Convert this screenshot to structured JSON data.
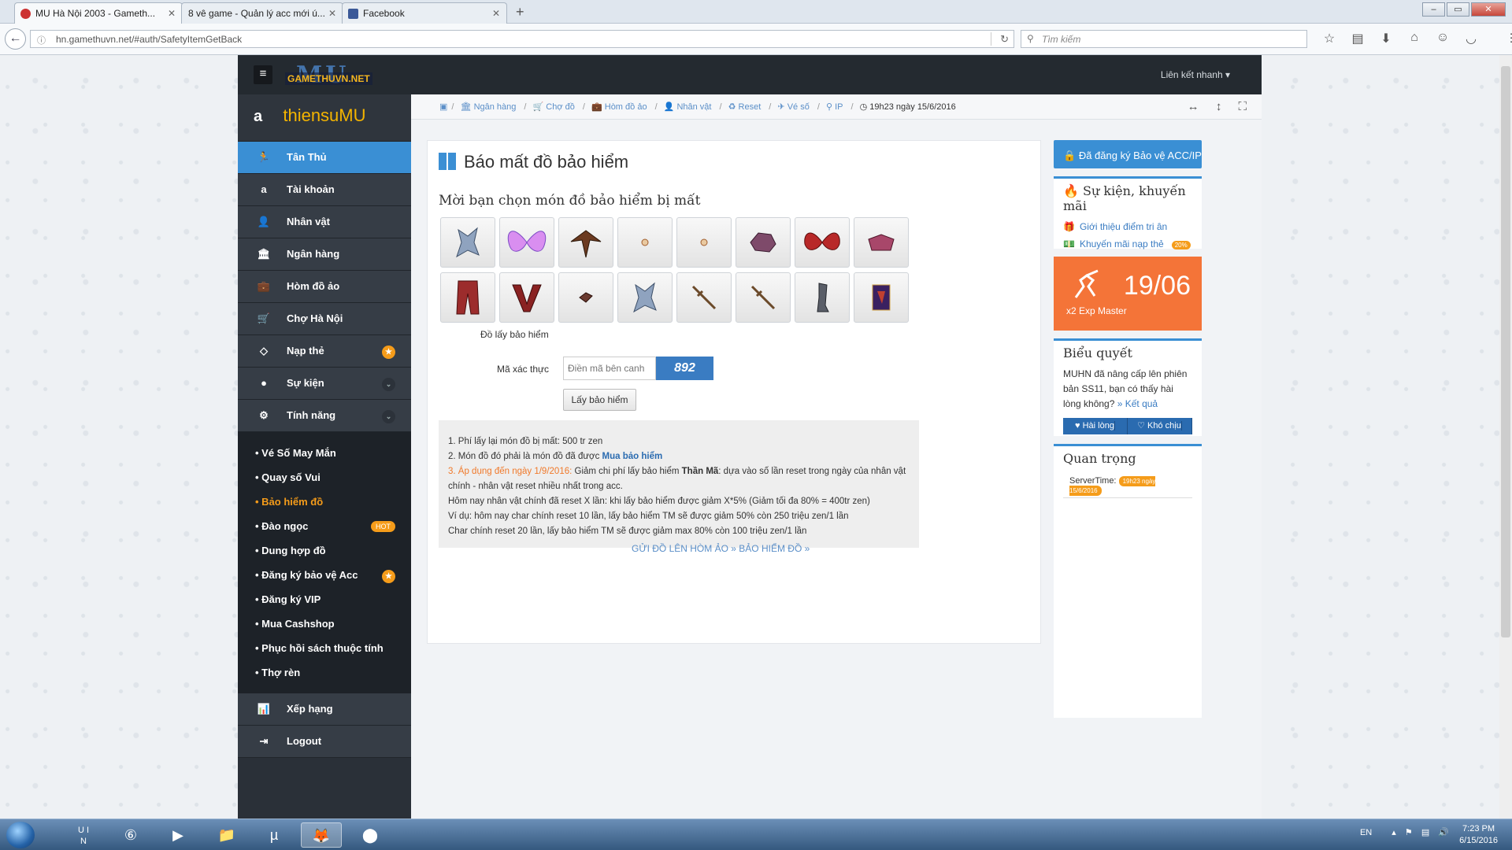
{
  "browser": {
    "tabs": [
      {
        "title": "MU Hà Nội 2003 - Gameth..."
      },
      {
        "title": "8 vê game - Quản lý acc mới ú..."
      },
      {
        "title": "Facebook"
      }
    ],
    "url": "hn.gamethuvn.net/#auth/SafetyItemGetBack",
    "search_placeholder": "Tìm kiếm"
  },
  "header": {
    "logo_big": "MU",
    "logo_small": "GAMETHUVN.NET",
    "quick_link": "Liên kết nhanh"
  },
  "sidebar": {
    "username": "thiensuMU",
    "items": [
      {
        "label": "Tân Thủ",
        "icon": "user-run-icon"
      },
      {
        "label": "Tài khoản",
        "icon": "amazon-icon"
      },
      {
        "label": "Nhân vật",
        "icon": "user-icon"
      },
      {
        "label": "Ngân hàng",
        "icon": "bank-icon"
      },
      {
        "label": "Hòm đồ ảo",
        "icon": "briefcase-icon"
      },
      {
        "label": "Chợ Hà Nội",
        "icon": "cart-icon"
      },
      {
        "label": "Nạp thẻ",
        "icon": "diamond-icon"
      },
      {
        "label": "Sự kiện",
        "icon": "apple-icon"
      },
      {
        "label": "Tính năng",
        "icon": "gears-icon"
      }
    ],
    "sub_items": [
      {
        "label": "• Vé Số May Mắn"
      },
      {
        "label": "• Quay số Vui"
      },
      {
        "label": "• Bảo hiểm đồ"
      },
      {
        "label": "• Đào ngọc",
        "badge": "HOT"
      },
      {
        "label": "• Dung hợp đồ"
      },
      {
        "label": "• Đăng ký bảo vệ Acc"
      },
      {
        "label": "• Đăng ký VIP"
      },
      {
        "label": "• Mua Cashshop"
      },
      {
        "label": "• Phục hồi sách thuộc tính"
      },
      {
        "label": "• Thợ rèn"
      }
    ],
    "bottom_items": [
      {
        "label": "Xếp hạng"
      },
      {
        "label": "Logout"
      }
    ]
  },
  "breadcrumb": {
    "items": [
      "Ngân hàng",
      "Chợ đồ",
      "Hòm đồ ảo",
      "Nhân vật",
      "Reset",
      "Vé số",
      "IP"
    ],
    "time": "19h23 ngày 15/6/2016"
  },
  "main": {
    "title": "Báo mất đồ bảo hiểm",
    "choose_label": "Mời bạn chọn món đồ bảo hiểm bị mất",
    "items_caption": "Đồ lấy bảo hiểm",
    "captcha_label": "Mã xác thực",
    "captcha_placeholder": "Điền mã bên canh",
    "captcha_code": "892",
    "submit_label": "Lấy bảo hiểm",
    "notes": {
      "line1": "1. Phí lấy lại món đồ bị mất: 500 tr zen",
      "line2_prefix": "2. Món đồ đó phải là món đồ đã được ",
      "line2_link": "Mua bảo hiểm",
      "line3_orange": "3. Áp dụng đến ngày 1/9/2016:",
      "line3_a": " Giảm chi phí lấy bảo hiểm ",
      "line3_bold": "Thần Mã",
      "line3_b": ": dựa vào số lần reset trong ngày của nhân vật chính - nhân vật reset nhiều nhất trong acc.",
      "line4": "Hôm nay nhân vật chính đã reset X lần: khi lấy bảo hiểm được giảm X*5% (Giảm tối đa 80% = 400tr zen)",
      "line5": "Ví dụ: hôm nay char chính reset 10 lần, lấy bảo hiểm TM sẽ được giảm 50% còn 250 triệu zen/1 lần",
      "line6": "Char chính reset 20 lần, lấy bảo hiểm TM sẽ được giảm max 80% còn 100 triệu zen/1 lần"
    },
    "footer_link1": "GỬI ĐỒ LÊN HÒM ẢO",
    "footer_link2": "BẢO HIỂM ĐỒ"
  },
  "right": {
    "register_btn": "Đã đăng ký Bảo vệ ACC/IP",
    "events_title": "Sự kiện, khuyến mãi",
    "event_link1": "Giới thiệu điểm tri ân",
    "event_link2": "Khuyến mãi nạp thẻ",
    "event_badge": "20%",
    "promo_date": "19/06",
    "promo_label": "x2 Exp Master",
    "poll_title": "Biểu quyết",
    "poll_text": "MUHN đã nâng cấp lên phiên bản SS11, bạn có thấy hài lòng không?",
    "poll_link": "» Kết quả",
    "poll_yes": "Hài lòng",
    "poll_no": "Khó chịu",
    "important_title": "Quan trọng",
    "server_label": "ServerTime:",
    "server_time": "19h23 ngày 15/6/2016"
  },
  "taskbar": {
    "lang": "EN",
    "time": "7:23 PM",
    "date": "6/15/2016"
  },
  "colors": {
    "accent": "#3a8fd4",
    "orange": "#f59c1a",
    "sidebar": "#2a3038"
  }
}
